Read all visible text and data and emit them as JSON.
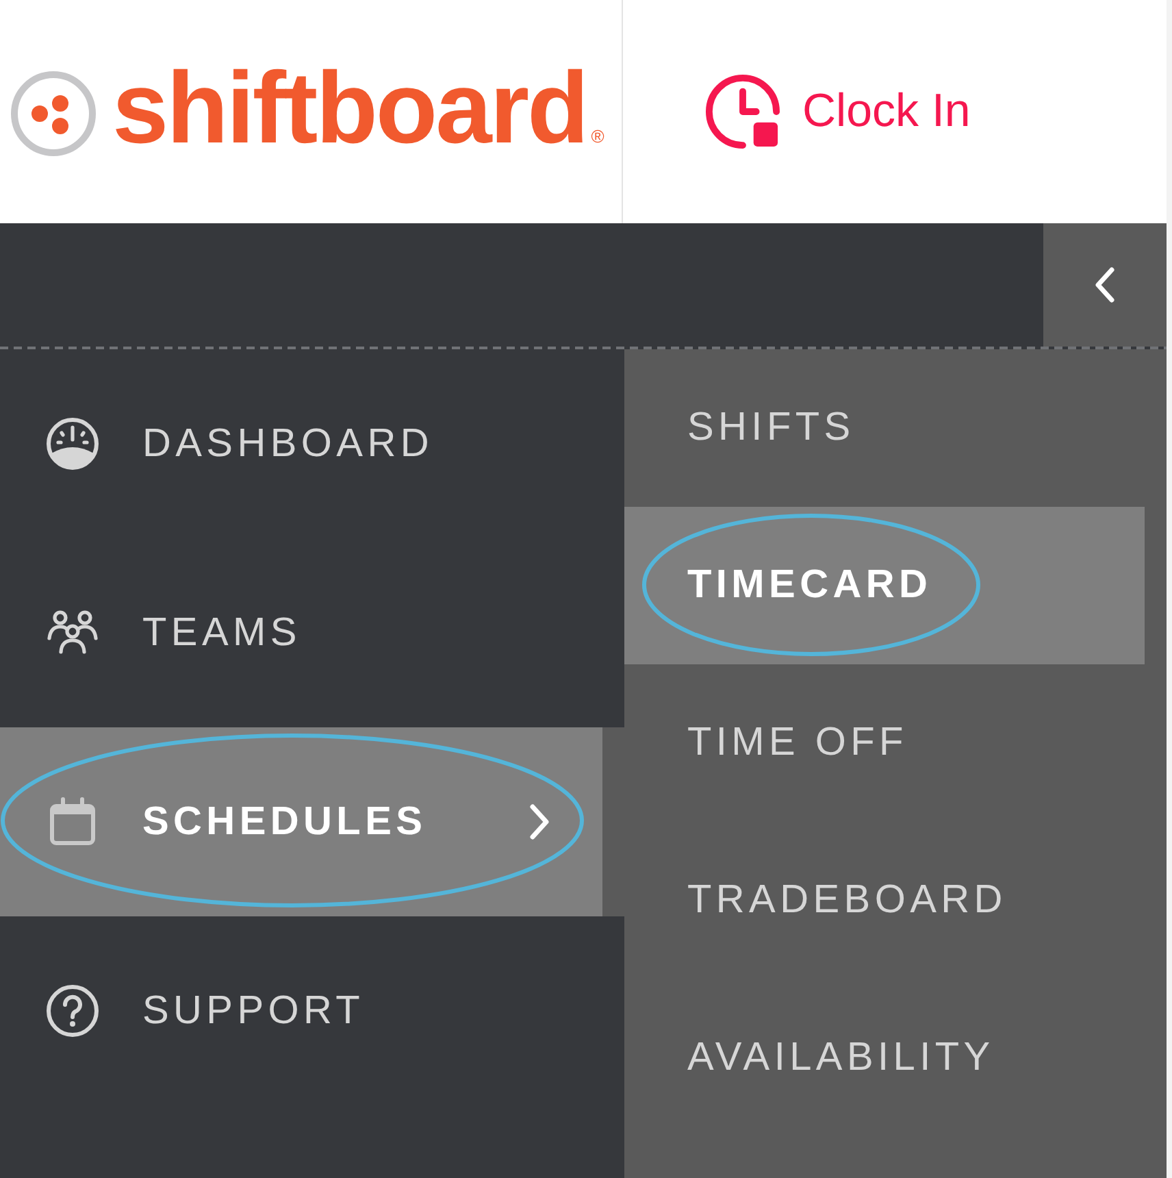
{
  "header": {
    "logo": {
      "wordmark": "shiftboard",
      "registered_mark": "®"
    },
    "clock_in": {
      "label": "Clock In"
    }
  },
  "nav": {
    "items": [
      {
        "kind": "dashboard",
        "label": "DASHBOARD",
        "selected": false,
        "expanded": false,
        "circled": false
      },
      {
        "kind": "teams",
        "label": "TEAMS",
        "selected": false,
        "expanded": false,
        "circled": false
      },
      {
        "kind": "schedules",
        "label": "SCHEDULES",
        "selected": true,
        "expanded": true,
        "circled": true
      },
      {
        "kind": "support",
        "label": "SUPPORT",
        "selected": false,
        "expanded": false,
        "circled": false
      }
    ]
  },
  "submenu": {
    "items": [
      {
        "label": "SHIFTS",
        "selected": false,
        "circled": false
      },
      {
        "label": "TIMECARD",
        "selected": true,
        "circled": true
      },
      {
        "label": "TIME OFF",
        "selected": false,
        "circled": false
      },
      {
        "label": "TRADEBOARD",
        "selected": false,
        "circled": false
      },
      {
        "label": "AVAILABILITY",
        "selected": false,
        "circled": false
      }
    ]
  }
}
